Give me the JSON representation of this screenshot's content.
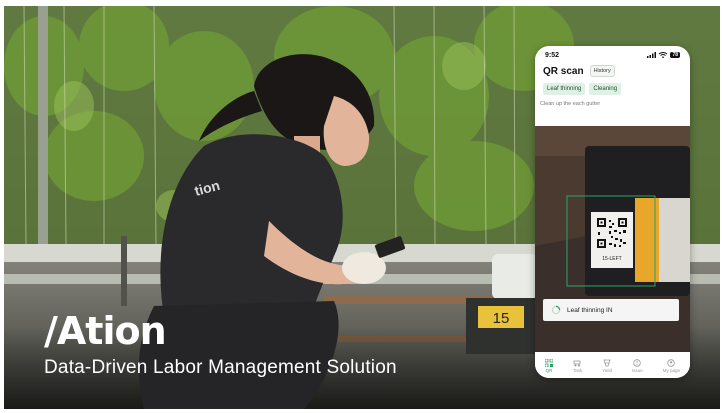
{
  "brand": {
    "logo": "/Ation",
    "tagline": "Data-Driven Labor Management Solution"
  },
  "shirt_text": "tion",
  "phone": {
    "status_time": "9:52",
    "battery": "78",
    "title": "QR scan",
    "history_label": "History",
    "chips": [
      "Leaf thinning",
      "Cleaning"
    ],
    "hint": "Clean up the each gutter",
    "qr_code_label": "15-LEFT",
    "toast_text": "Leaf thinning IN",
    "nav": [
      {
        "label": "QR",
        "icon": "qr-icon",
        "active": true
      },
      {
        "label": "Task",
        "icon": "cart-icon",
        "active": false
      },
      {
        "label": "Yield",
        "icon": "scale-icon",
        "active": false
      },
      {
        "label": "Issue",
        "icon": "alert-icon",
        "active": false
      },
      {
        "label": "My page",
        "icon": "user-icon",
        "active": false
      }
    ]
  },
  "scene": {
    "row_sign_number": "15"
  },
  "colors": {
    "accent": "#2aa46a",
    "chip_bg": "#dff1e5",
    "sign_yellow": "#e8c23a"
  }
}
